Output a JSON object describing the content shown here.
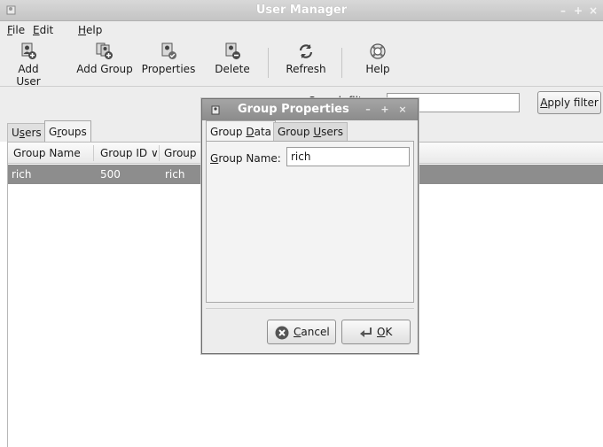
{
  "window": {
    "title": "User Manager",
    "controls": [
      "–",
      "+",
      "×"
    ]
  },
  "menu": {
    "file_rest": "ile",
    "file_key": "F",
    "edit_rest": "dit",
    "edit_key": "E",
    "help_rest": "elp",
    "help_key": "H"
  },
  "toolbar": {
    "add_user": "Add User",
    "add_group": "Add Group",
    "properties": "Properties",
    "delete": "Delete",
    "refresh": "Refresh",
    "help": "Help"
  },
  "filter": {
    "label": "Search filter:",
    "value": "",
    "apply_key": "A",
    "apply_rest": "pply filter"
  },
  "tabs": {
    "users_pre": "U",
    "users_key": "s",
    "users_post": "ers",
    "groups_pre": "G",
    "groups_key": "r",
    "groups_post": "oups"
  },
  "table": {
    "columns": [
      "Group Name",
      "Group ID ∨",
      "Group M"
    ],
    "rows": [
      {
        "name": "rich",
        "id": "500",
        "members": "rich"
      }
    ]
  },
  "dialog": {
    "title": "Group Properties",
    "controls": [
      "–",
      "+",
      "×"
    ],
    "tab_data_pre": "Group ",
    "tab_data_key": "D",
    "tab_data_post": "ata",
    "tab_users_pre": "Group ",
    "tab_users_key": "U",
    "tab_users_post": "sers",
    "name_label_key": "G",
    "name_label_rest": "roup Name:",
    "name_value": "rich",
    "cancel_key": "C",
    "cancel_rest": "ancel",
    "ok_key": "O",
    "ok_rest": "K"
  },
  "colors": {
    "selected_row": "#8d8d8d",
    "dialog_titlebar": "#999999"
  }
}
